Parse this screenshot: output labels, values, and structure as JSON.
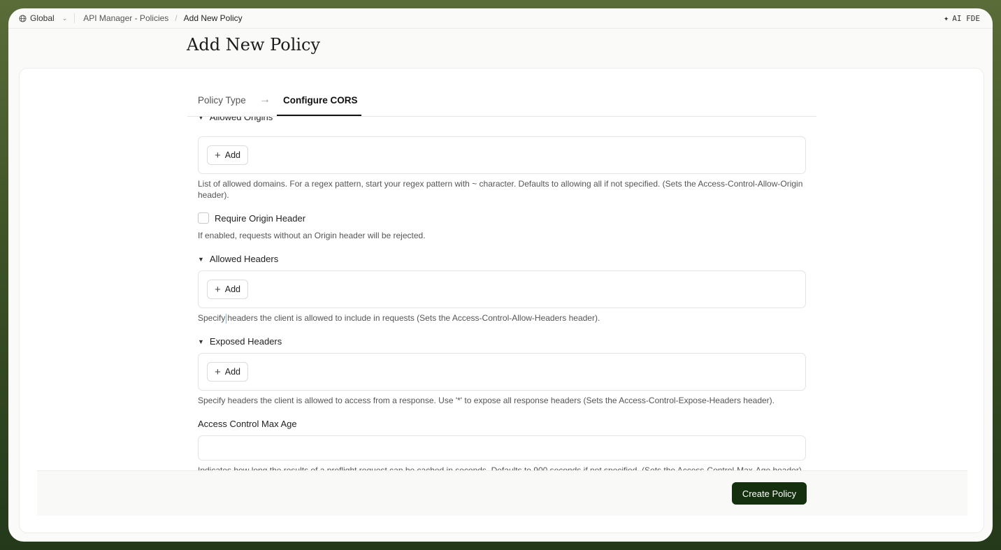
{
  "topbar": {
    "workspace": "Global",
    "breadcrumb": [
      "API Manager - Policies",
      "Add New Policy"
    ],
    "ai_label": "AI FDE"
  },
  "page": {
    "title": "Add New Policy"
  },
  "tabs": {
    "step1": "Policy Type",
    "step2": "Configure CORS"
  },
  "form": {
    "allowed_origins": {
      "label": "Allowed Origins",
      "add_label": "Add",
      "help": "List of allowed domains. For a regex pattern, start your regex pattern with ~ character. Defaults to allowing all if not specified. (Sets the Access-Control-Allow-Origin header)."
    },
    "require_origin": {
      "label": "Require Origin Header",
      "checked": false,
      "help": "If enabled, requests without an Origin header will be rejected."
    },
    "allowed_headers": {
      "label": "Allowed Headers",
      "add_label": "Add",
      "help_before": "Specify",
      "help_after": "headers the client is allowed to include in requests (Sets the Access-Control-Allow-Headers header)."
    },
    "exposed_headers": {
      "label": "Exposed Headers",
      "add_label": "Add",
      "help": "Specify headers the client is allowed to access from a response. Use '*' to expose all response headers (Sets the Access-Control-Expose-Headers header)."
    },
    "max_age": {
      "label": "Access Control Max Age",
      "value": "",
      "help": "Indicates how long the results of a preflight request can be cached in seconds. Defaults to 900 seconds if not specified. (Sets the Access-Control-Max-Age header)."
    }
  },
  "footer": {
    "submit_label": "Create Policy"
  },
  "colors": {
    "primary": "#14300f",
    "frame_bg": "#3d5226"
  }
}
